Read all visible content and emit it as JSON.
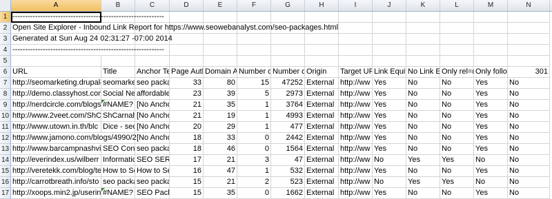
{
  "columns": [
    "A",
    "B",
    "C",
    "D",
    "E",
    "F",
    "G",
    "H",
    "I",
    "J",
    "K",
    "L",
    "M",
    "N"
  ],
  "rows": [
    {
      "n": "1",
      "cells": [
        {
          "t": "------------------------------------------------------------",
          "spill": true
        }
      ]
    },
    {
      "n": "2",
      "cells": [
        {
          "t": "Open Site Explorer - Inbound Link Report for https://www.seowebanalyst.com/seo-packages.html",
          "spill": true
        }
      ]
    },
    {
      "n": "3",
      "cells": [
        {
          "t": "Generated at Sun Aug 24 02:31:27 -07:00 2014",
          "spill": true
        }
      ]
    },
    {
      "n": "4",
      "cells": [
        {
          "t": "------------------------------------------------------------",
          "spill": true
        }
      ]
    },
    {
      "n": "5",
      "cells": []
    },
    {
      "n": "6",
      "cells": [
        {
          "t": "URL"
        },
        {
          "t": "Title"
        },
        {
          "t": "Anchor Te"
        },
        {
          "t": "Page Auth"
        },
        {
          "t": "Domain A"
        },
        {
          "t": "Number o"
        },
        {
          "t": "Number o"
        },
        {
          "t": "Origin"
        },
        {
          "t": "Target URI"
        },
        {
          "t": "Link Equit"
        },
        {
          "t": "No Link Ec"
        },
        {
          "t": "Only rel=n"
        },
        {
          "t": "Only follo"
        },
        {
          "t": "301",
          "num": true
        }
      ]
    },
    {
      "n": "7",
      "cells": [
        {
          "t": "http://seomarketing.drupalg"
        },
        {
          "t": "seomarke"
        },
        {
          "t": "seo packa"
        },
        {
          "t": "33",
          "num": true
        },
        {
          "t": "80",
          "num": true
        },
        {
          "t": "15",
          "num": true
        },
        {
          "t": "47252",
          "num": true
        },
        {
          "t": "External"
        },
        {
          "t": "http://ww"
        },
        {
          "t": "Yes"
        },
        {
          "t": "No"
        },
        {
          "t": "No"
        },
        {
          "t": "Yes"
        },
        {
          "t": "No"
        }
      ]
    },
    {
      "n": "8",
      "cells": [
        {
          "t": "http://demo.classyhost.com"
        },
        {
          "t": "Social Nev"
        },
        {
          "t": "affordable"
        },
        {
          "t": "23",
          "num": true
        },
        {
          "t": "39",
          "num": true
        },
        {
          "t": "5",
          "num": true
        },
        {
          "t": "2973",
          "num": true
        },
        {
          "t": "External"
        },
        {
          "t": "http://ww"
        },
        {
          "t": "Yes"
        },
        {
          "t": "No"
        },
        {
          "t": "No"
        },
        {
          "t": "Yes"
        },
        {
          "t": "No"
        }
      ]
    },
    {
      "n": "9",
      "cells": [
        {
          "t": "http://nerdcircle.com/blogs"
        },
        {
          "t": "#NAME?",
          "tri": true
        },
        {
          "t": "[No Ancho"
        },
        {
          "t": "21",
          "num": true
        },
        {
          "t": "35",
          "num": true
        },
        {
          "t": "1",
          "num": true
        },
        {
          "t": "3764",
          "num": true
        },
        {
          "t": "External"
        },
        {
          "t": "http://ww"
        },
        {
          "t": "Yes"
        },
        {
          "t": "No"
        },
        {
          "t": "No"
        },
        {
          "t": "Yes"
        },
        {
          "t": "No"
        }
      ]
    },
    {
      "n": "10",
      "cells": [
        {
          "t": "http://www.2veet.com/ShCa"
        },
        {
          "t": "ShCarnahe"
        },
        {
          "t": "[No Ancho"
        },
        {
          "t": "21",
          "num": true
        },
        {
          "t": "19",
          "num": true
        },
        {
          "t": "1",
          "num": true
        },
        {
          "t": "4993",
          "num": true
        },
        {
          "t": "External"
        },
        {
          "t": "http://ww"
        },
        {
          "t": "Yes"
        },
        {
          "t": "No"
        },
        {
          "t": "No"
        },
        {
          "t": "Yes"
        },
        {
          "t": "No"
        }
      ]
    },
    {
      "n": "11",
      "cells": [
        {
          "t": "http://www.utown.in.th/blc"
        },
        {
          "t": "Dice - seo"
        },
        {
          "t": "[No Ancho"
        },
        {
          "t": "20",
          "num": true
        },
        {
          "t": "29",
          "num": true
        },
        {
          "t": "1",
          "num": true
        },
        {
          "t": "477",
          "num": true
        },
        {
          "t": "External"
        },
        {
          "t": "http://ww"
        },
        {
          "t": "Yes"
        },
        {
          "t": "No"
        },
        {
          "t": "No"
        },
        {
          "t": "Yes"
        },
        {
          "t": "No"
        }
      ]
    },
    {
      "n": "12",
      "cells": [
        {
          "t": "http://www.jamono.com/blogs/4990/2"
        },
        {
          "t": "[No Ancho"
        },
        {
          "t": "18",
          "num": true,
          "col": "D",
          "skip": true
        },
        {
          "t": "18",
          "num": true
        },
        {
          "t": "33",
          "num": true
        },
        {
          "t": "0",
          "num": true
        },
        {
          "t": "2442",
          "num": true
        },
        {
          "t": "External"
        },
        {
          "t": "http://ww"
        },
        {
          "t": "Yes"
        },
        {
          "t": "No"
        },
        {
          "t": "No"
        },
        {
          "t": "Yes"
        },
        {
          "t": "No"
        }
      ]
    },
    {
      "n": "13",
      "cells": [
        {
          "t": "http://www.barcampnashvil"
        },
        {
          "t": "SEO Consu"
        },
        {
          "t": "seo packa"
        },
        {
          "t": "18",
          "num": true
        },
        {
          "t": "46",
          "num": true
        },
        {
          "t": "0",
          "num": true
        },
        {
          "t": "1564",
          "num": true
        },
        {
          "t": "External"
        },
        {
          "t": "http://ww"
        },
        {
          "t": "Yes"
        },
        {
          "t": "No"
        },
        {
          "t": "No"
        },
        {
          "t": "Yes"
        },
        {
          "t": "No"
        }
      ]
    },
    {
      "n": "14",
      "cells": [
        {
          "t": "http://everindex.us/wilberr"
        },
        {
          "t": "Informatic"
        },
        {
          "t": "SEO SERVI"
        },
        {
          "t": "17",
          "num": true
        },
        {
          "t": "21",
          "num": true
        },
        {
          "t": "3",
          "num": true
        },
        {
          "t": "47",
          "num": true
        },
        {
          "t": "External"
        },
        {
          "t": "http://ww"
        },
        {
          "t": "No"
        },
        {
          "t": "Yes"
        },
        {
          "t": "Yes"
        },
        {
          "t": "No"
        },
        {
          "t": "No"
        }
      ]
    },
    {
      "n": "15",
      "cells": [
        {
          "t": "http://veretekk.com/blog/te"
        },
        {
          "t": "How to Se"
        },
        {
          "t": "How to Se"
        },
        {
          "t": "16",
          "num": true
        },
        {
          "t": "47",
          "num": true
        },
        {
          "t": "1",
          "num": true
        },
        {
          "t": "532",
          "num": true
        },
        {
          "t": "External"
        },
        {
          "t": "http://ww"
        },
        {
          "t": "Yes"
        },
        {
          "t": "No"
        },
        {
          "t": "No"
        },
        {
          "t": "Yes"
        },
        {
          "t": "No"
        }
      ]
    },
    {
      "n": "16",
      "cells": [
        {
          "t": "http://carrotbreath.info/sto"
        },
        {
          "t": "seo packa"
        },
        {
          "t": "seo packa"
        },
        {
          "t": "15",
          "num": true
        },
        {
          "t": "21",
          "num": true
        },
        {
          "t": "2",
          "num": true
        },
        {
          "t": "523",
          "num": true
        },
        {
          "t": "External"
        },
        {
          "t": "http://ww"
        },
        {
          "t": "No"
        },
        {
          "t": "Yes"
        },
        {
          "t": "Yes"
        },
        {
          "t": "No"
        },
        {
          "t": "No"
        }
      ]
    },
    {
      "n": "17",
      "cells": [
        {
          "t": "http://xoops.min2.jp/userin"
        },
        {
          "t": "#NAME?",
          "tri": true
        },
        {
          "t": "SEO Pack"
        },
        {
          "t": "15",
          "num": true
        },
        {
          "t": "35",
          "num": true
        },
        {
          "t": "0",
          "num": true
        },
        {
          "t": "1662",
          "num": true
        },
        {
          "t": "External"
        },
        {
          "t": "http://ww"
        },
        {
          "t": "Yes"
        },
        {
          "t": "No"
        },
        {
          "t": "No"
        },
        {
          "t": "Yes"
        },
        {
          "t": "No"
        }
      ]
    }
  ]
}
